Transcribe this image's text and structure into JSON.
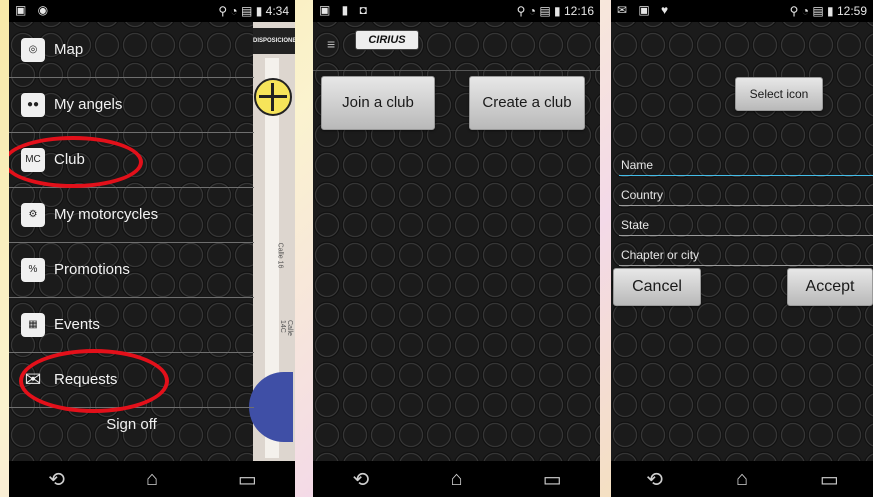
{
  "phone1": {
    "status": {
      "time": "4:34"
    },
    "menu": [
      {
        "label": "Map",
        "icon": "map-pin-icon"
      },
      {
        "label": "My angels",
        "icon": "people-icon"
      },
      {
        "label": "Club",
        "icon": "club-mc-icon"
      },
      {
        "label": "My motorcycles",
        "icon": "motorcycle-icon"
      },
      {
        "label": "Promotions",
        "icon": "discount-tag-icon"
      },
      {
        "label": "Events",
        "icon": "calendar-icon"
      },
      {
        "label": "Requests",
        "icon": "envelope-icon"
      }
    ],
    "sign_off": "Sign off",
    "map_ad": "DISPOSICIONE",
    "map_street_1": "Calle 16",
    "map_street_2": "Calle 14C",
    "highlight_color": "#e3101a"
  },
  "phone2": {
    "status": {
      "time": "12:16"
    },
    "logo": "CIRIUS",
    "join_button": "Join a club",
    "create_button": "Create a club"
  },
  "phone3": {
    "status": {
      "time": "12:59"
    },
    "select_icon_button": "Select icon",
    "fields": [
      {
        "placeholder": "Name"
      },
      {
        "placeholder": "Country"
      },
      {
        "placeholder": "State"
      },
      {
        "placeholder": "Chapter or city"
      }
    ],
    "cancel_button": "Cancel",
    "accept_button": "Accept",
    "focus_color": "#44bde8"
  }
}
